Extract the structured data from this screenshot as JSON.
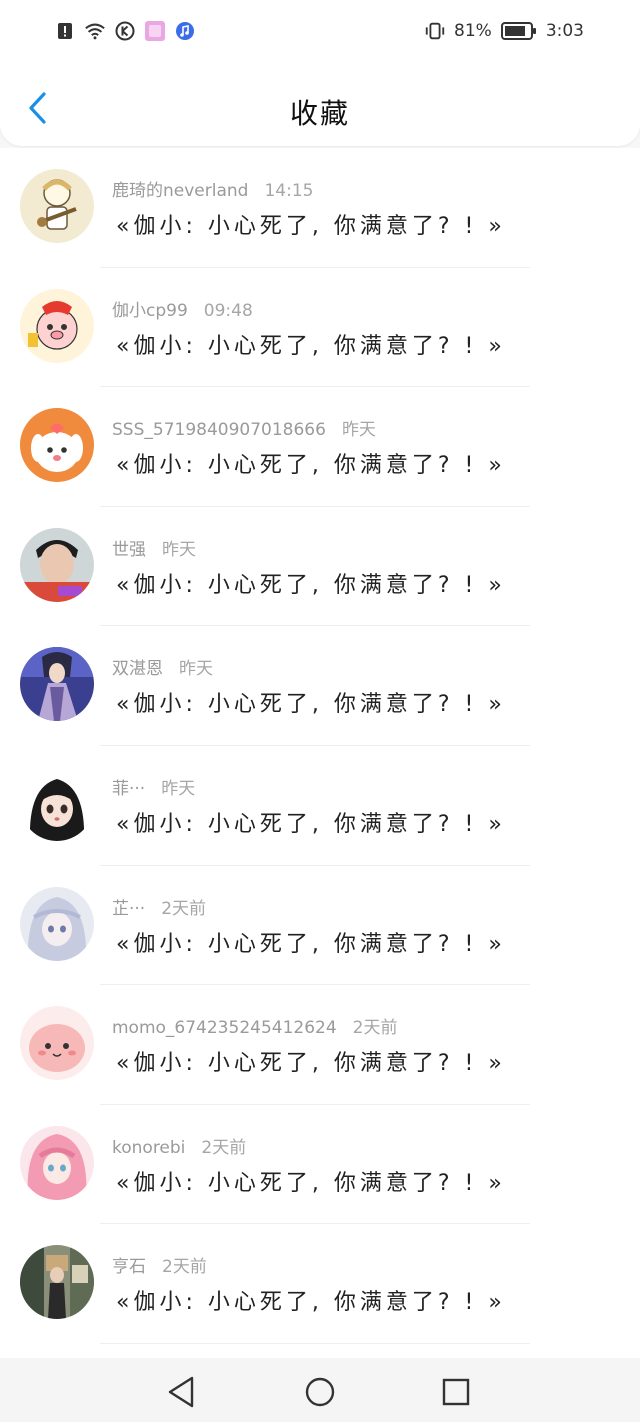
{
  "status_bar": {
    "battery_percent": "81%",
    "time": "3:03",
    "left_icons": [
      "alert-icon",
      "wifi-icon",
      "k-app-icon",
      "pink-app-icon",
      "music-app-icon"
    ],
    "right_icons": [
      "vibrate-icon",
      "battery-icon"
    ]
  },
  "header": {
    "title": "收藏",
    "back_icon": "chevron-left-icon",
    "accent_color": "#1a8fe6"
  },
  "items": [
    {
      "name": "鹿琦的neverland",
      "time": "14:15",
      "message": "«伽小: 小心死了, 你满意了? ! »",
      "avatar": "avatar-cartoon-guitar"
    },
    {
      "name": "伽小cp99",
      "time": "09:48",
      "message": "«伽小: 小心死了, 你满意了? ! »",
      "avatar": "avatar-cartoon-pig"
    },
    {
      "name": "SSS_5719840907018666",
      "time": "昨天",
      "message": "«伽小: 小心死了, 你满意了? ! »",
      "avatar": "avatar-cartoon-dog"
    },
    {
      "name": "世强",
      "time": "昨天",
      "message": "«伽小: 小心死了, 你满意了? ! »",
      "avatar": "avatar-photo-man"
    },
    {
      "name": "双湛恩",
      "time": "昨天",
      "message": "«伽小: 小心死了, 你满意了? ! »",
      "avatar": "avatar-anime-purple"
    },
    {
      "name": "菲···",
      "time": "昨天",
      "message": "«伽小: 小心死了, 你满意了? ! »",
      "avatar": "avatar-anime-girl-dark"
    },
    {
      "name": "芷···",
      "time": "2天前",
      "message": "«伽小: 小心死了, 你满意了? ! »",
      "avatar": "avatar-anime-girl-light"
    },
    {
      "name": "momo_674235245412624",
      "time": "2天前",
      "message": "«伽小: 小心死了, 你满意了? ! »",
      "avatar": "avatar-cartoon-pink"
    },
    {
      "name": "konorebi",
      "time": "2天前",
      "message": "«伽小: 小心死了, 你满意了? ! »",
      "avatar": "avatar-anime-pink-hair"
    },
    {
      "name": "亨石",
      "time": "2天前",
      "message": "«伽小: 小心死了, 你满意了? ! »",
      "avatar": "avatar-photo-street"
    }
  ],
  "bottom_nav": {
    "icons": [
      "nav-back-icon",
      "nav-home-icon",
      "nav-recents-icon"
    ]
  }
}
